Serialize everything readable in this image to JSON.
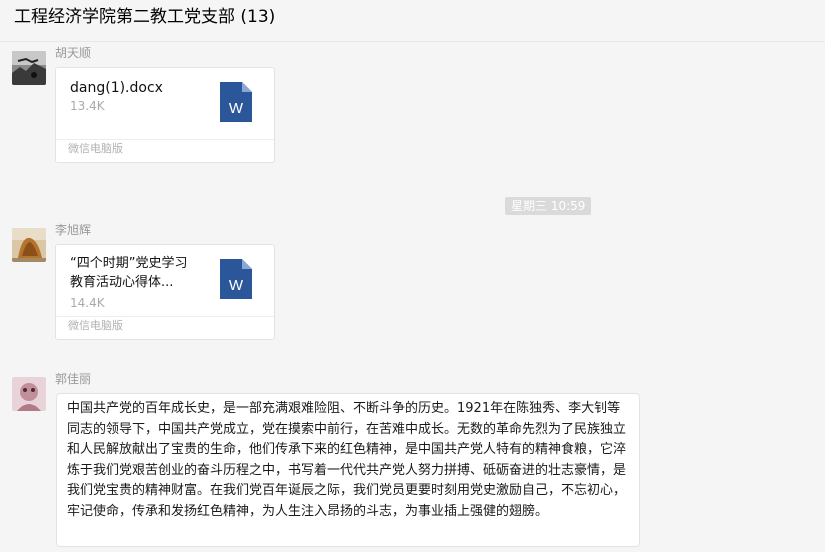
{
  "window": {
    "title": "工程经济学院第二教工党支部 (13)"
  },
  "messages": [
    {
      "sender": "胡天顺",
      "type": "file",
      "file": {
        "name": "dang(1).docx",
        "size": "13.4K",
        "source": "微信电脑版",
        "icon": "word-doc-icon"
      }
    },
    {
      "type": "time",
      "text": "星期三 10:59"
    },
    {
      "sender": "李旭辉",
      "type": "file",
      "file": {
        "name": "“四个时期”党史学习教育活动心得体...",
        "size": "14.4K",
        "source": "微信电脑版",
        "icon": "word-doc-icon"
      }
    },
    {
      "sender": "郭佳丽",
      "type": "text",
      "text": "中国共产党的百年成长史，是一部充满艰难险阻、不断斗争的历史。1921年在陈独秀、李大钊等同志的领导下，中国共产党成立，党在摸索中前行，在苦难中成长。无数的革命先烈为了民族独立和人民解放献出了宝贵的生命，他们传承下来的红色精神，是中国共产党人特有的精神食粮，它淬炼于我们党艰苦创业的奋斗历程之中，书写着一代代共产党人努力拼搏、砥砺奋进的壮志豪情，是我们党宝贵的精神财富。在我们党百年诞辰之际，我们党员更要时刻用党史激励自己，不忘初心，牢记使命，传承和发扬红色精神，为人生注入昂扬的斗志，为事业插上强健的翅膀。"
    }
  ],
  "colors": {
    "word_blue": "#2b579a",
    "bg": "#f5f5f5"
  }
}
